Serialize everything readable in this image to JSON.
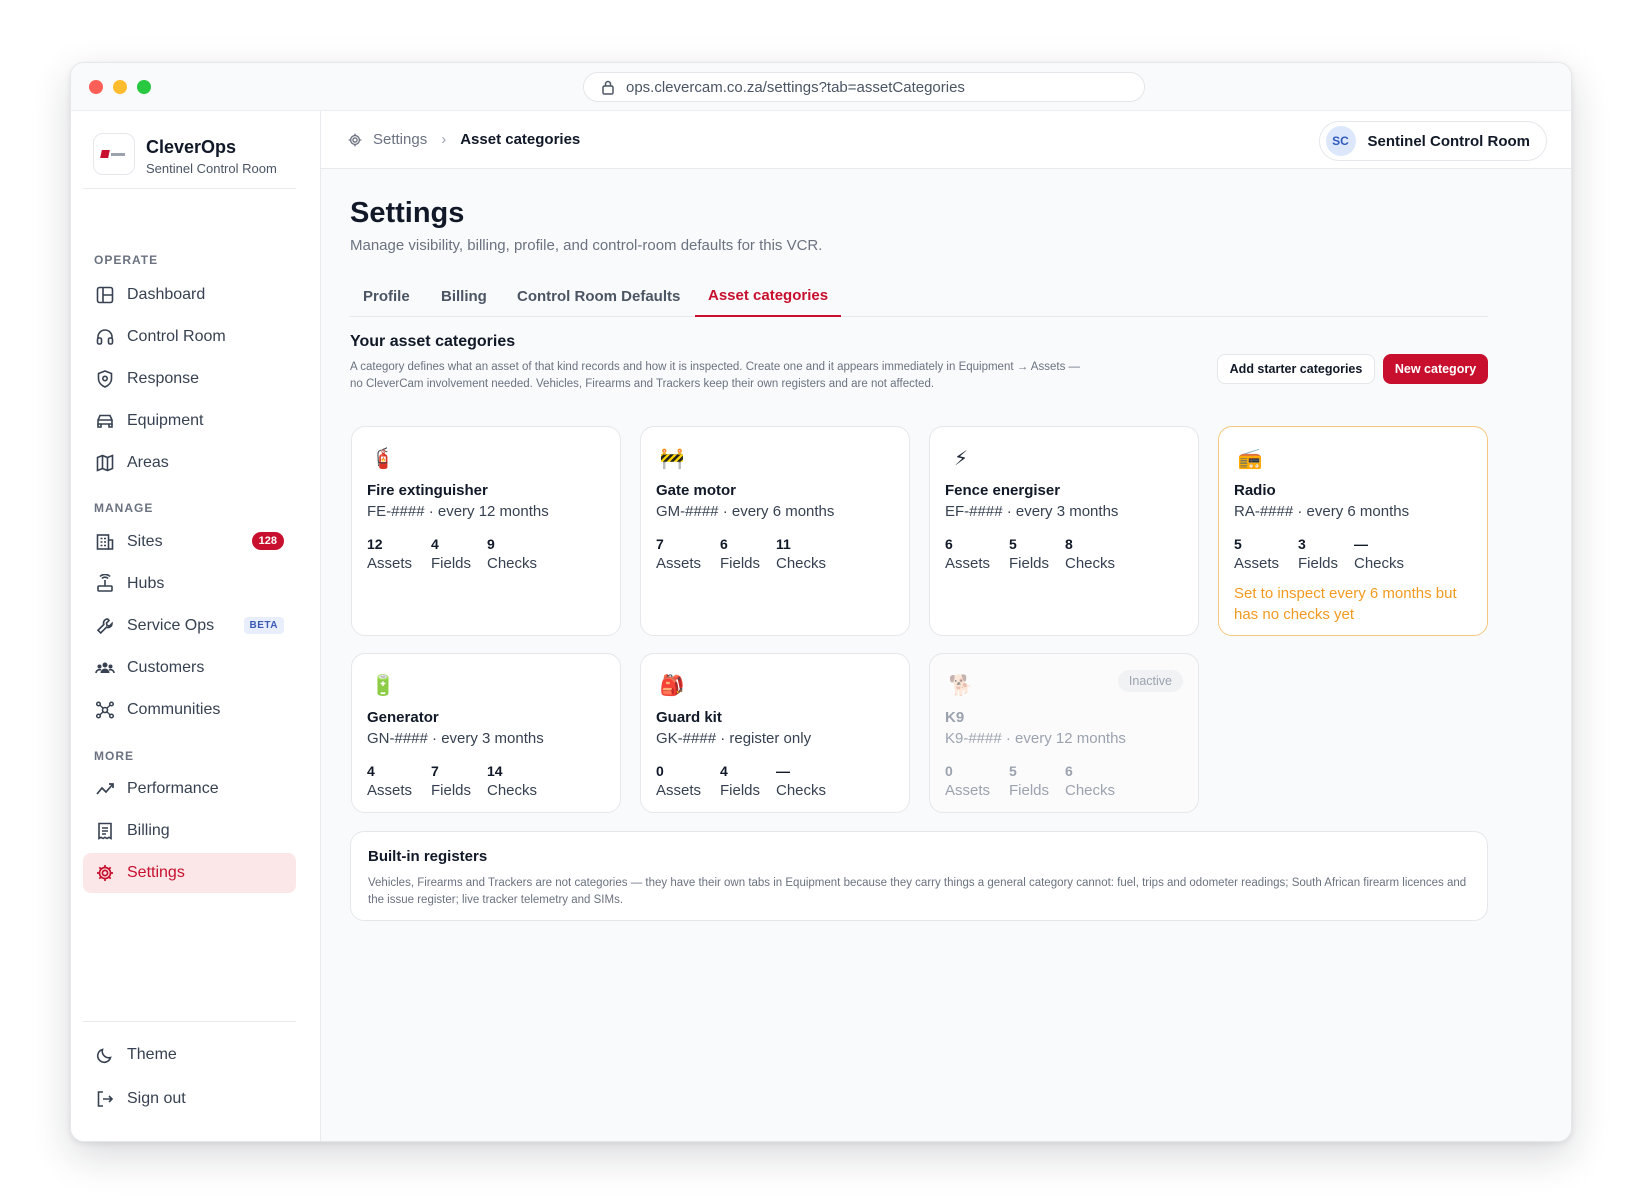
{
  "browser": {
    "url": "ops.clevercam.co.za/settings?tab=assetCategories"
  },
  "brand": {
    "name": "CleverOps",
    "org": "Sentinel Control Room"
  },
  "sidebar": {
    "sections": {
      "operate": "OPERATE",
      "manage": "MANAGE",
      "more": "MORE"
    },
    "operate": [
      {
        "label": "Dashboard",
        "icon": "dashboard-icon"
      },
      {
        "label": "Control Room",
        "icon": "headset-icon"
      },
      {
        "label": "Response",
        "icon": "shield-icon"
      },
      {
        "label": "Equipment",
        "icon": "vehicle-icon"
      },
      {
        "label": "Areas",
        "icon": "map-icon"
      }
    ],
    "manage": [
      {
        "label": "Sites",
        "icon": "building-icon",
        "badge": "128"
      },
      {
        "label": "Hubs",
        "icon": "hub-icon"
      },
      {
        "label": "Service Ops",
        "icon": "wrench-icon",
        "tag": "BETA"
      },
      {
        "label": "Customers",
        "icon": "users-icon"
      },
      {
        "label": "Communities",
        "icon": "network-icon"
      }
    ],
    "more": [
      {
        "label": "Performance",
        "icon": "trend-icon"
      },
      {
        "label": "Billing",
        "icon": "receipt-icon"
      },
      {
        "label": "Settings",
        "icon": "gear-icon",
        "active": true
      }
    ],
    "footer": [
      {
        "label": "Theme",
        "icon": "moon-icon"
      },
      {
        "label": "Sign out",
        "icon": "sign-out-icon"
      }
    ]
  },
  "topbar": {
    "breadcrumb": {
      "parent": "Settings",
      "current": "Asset categories"
    },
    "user": {
      "initials": "SC",
      "name": "Sentinel Control Room"
    }
  },
  "page": {
    "title": "Settings",
    "subtitle": "Manage visibility, billing, profile, and control-room defaults for this VCR."
  },
  "tabs": [
    "Profile",
    "Billing",
    "Control Room Defaults",
    "Asset categories"
  ],
  "categories_section": {
    "title": "Your asset categories",
    "description": "A category defines what an asset of that kind records and how it is inspected. Create one and it appears immediately in Equipment → Assets — no CleverCam involvement needed. Vehicles, Firearms and Trackers keep their own registers and are not affected.",
    "add_starter_label": "Add starter categories",
    "new_category_label": "New category"
  },
  "stat_labels": {
    "assets": "Assets",
    "fields": "Fields",
    "checks": "Checks"
  },
  "categories": [
    {
      "emoji": "🧯",
      "name": "Fire extinguisher",
      "code": "FE-#### · every 12 months",
      "assets": "12",
      "fields": "4",
      "checks": "9"
    },
    {
      "emoji": "🚧",
      "name": "Gate motor",
      "code": "GM-#### · every 6 months",
      "assets": "7",
      "fields": "6",
      "checks": "11"
    },
    {
      "emoji": "⚡",
      "name": "Fence energiser",
      "code": "EF-#### · every 3 months",
      "assets": "6",
      "fields": "5",
      "checks": "8"
    },
    {
      "emoji": "📻",
      "name": "Radio",
      "code": "RA-#### · every 6 months",
      "assets": "5",
      "fields": "3",
      "checks": "—",
      "warning": "Set to inspect every 6 months but has no checks yet"
    },
    {
      "emoji": "🔋",
      "name": "Generator",
      "code": "GN-#### · every 3 months",
      "assets": "4",
      "fields": "7",
      "checks": "14"
    },
    {
      "emoji": "🎒",
      "name": "Guard kit",
      "code": "GK-#### · register only",
      "assets": "0",
      "fields": "4",
      "checks": "—"
    },
    {
      "emoji": "🐕",
      "name": "K9",
      "code": "K9-#### · every 12 months",
      "assets": "0",
      "fields": "5",
      "checks": "6",
      "status": "Inactive"
    }
  ],
  "registers": {
    "title": "Built-in registers",
    "description": "Vehicles, Firearms and Trackers are not categories — they have their own tabs in Equipment because they carry things a general category cannot: fuel, trips and odometer readings; South African firearm licences and the issue register; live tracker telemetry and SIMs."
  },
  "colors": {
    "accent": "#c8102e",
    "warning": "#f29a1f",
    "warning_border": "#f5c77e"
  }
}
